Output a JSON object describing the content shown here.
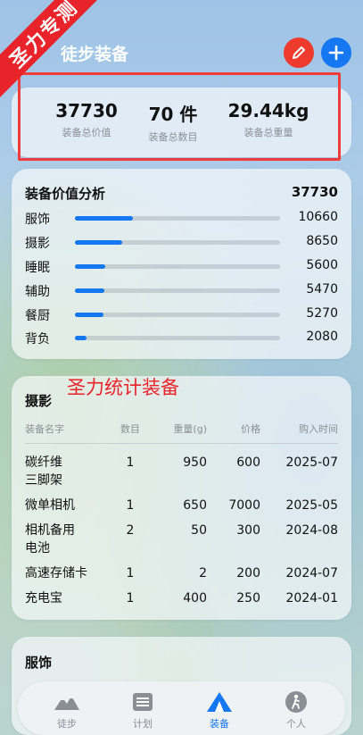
{
  "header": {
    "title": "徒步装备",
    "ribbon": "圣力专测"
  },
  "summary": [
    {
      "value": "37730",
      "label": "装备总价值"
    },
    {
      "value": "70 件",
      "label": "装备总数目"
    },
    {
      "value": "29.44kg",
      "label": "装备总重量"
    }
  ],
  "analysis": {
    "title": "装备价值分析",
    "total": "37730",
    "items": [
      {
        "name": "服饰",
        "value": "10660",
        "fraction": 0.283
      },
      {
        "name": "摄影",
        "value": "8650",
        "fraction": 0.229
      },
      {
        "name": "睡眠",
        "value": "5600",
        "fraction": 0.148
      },
      {
        "name": "辅助",
        "value": "5470",
        "fraction": 0.145
      },
      {
        "name": "餐厨",
        "value": "5270",
        "fraction": 0.14
      },
      {
        "name": "背负",
        "value": "2080",
        "fraction": 0.055
      }
    ]
  },
  "overlay_text": "圣力统计装备",
  "photography": {
    "title": "摄影",
    "columns": [
      "装备名字",
      "数目",
      "重量(g)",
      "价格",
      "购入时间"
    ],
    "rows": [
      [
        "碳纤维\n三脚架",
        "1",
        "950",
        "600",
        "2025-07"
      ],
      [
        "微单相机",
        "1",
        "650",
        "7000",
        "2025-05"
      ],
      [
        "相机备用\n电池",
        "2",
        "50",
        "300",
        "2024-08"
      ],
      [
        "高速存储卡",
        "1",
        "2",
        "200",
        "2024-07"
      ],
      [
        "充电宝",
        "1",
        "400",
        "250",
        "2024-01"
      ]
    ]
  },
  "clothing": {
    "title": "服饰"
  },
  "tabs": [
    {
      "label": "徒步",
      "icon": "mountain-icon",
      "active": false
    },
    {
      "label": "计划",
      "icon": "list-icon",
      "active": false
    },
    {
      "label": "装备",
      "icon": "tent-icon",
      "active": true
    },
    {
      "label": "个人",
      "icon": "hiker-icon",
      "active": false
    }
  ],
  "colors": {
    "accent": "#1677f2",
    "edit": "#ee3b2d",
    "ribbon": "#e8232a"
  }
}
